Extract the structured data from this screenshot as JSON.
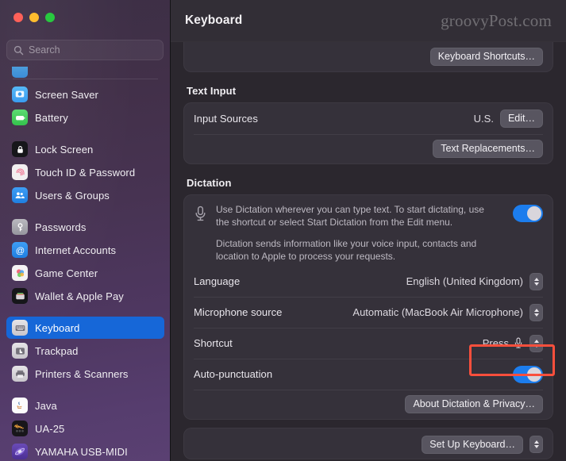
{
  "window": {
    "traffic_lights": [
      {
        "name": "close",
        "color": "#ff6159"
      },
      {
        "name": "minimize",
        "color": "#ffbd2e"
      },
      {
        "name": "zoom",
        "color": "#28c93f"
      }
    ]
  },
  "sidebar": {
    "search": {
      "placeholder": "Search",
      "value": ""
    },
    "groups": [
      {
        "items": [
          {
            "label": "",
            "icon": "app-icon",
            "clipped": true
          },
          {
            "label": "Screen Saver",
            "icon": "screen-saver-icon"
          },
          {
            "label": "Battery",
            "icon": "battery-icon"
          }
        ]
      },
      {
        "items": [
          {
            "label": "Lock Screen",
            "icon": "lock-screen-icon"
          },
          {
            "label": "Touch ID & Password",
            "icon": "touch-id-icon"
          },
          {
            "label": "Users & Groups",
            "icon": "users-groups-icon"
          }
        ]
      },
      {
        "items": [
          {
            "label": "Passwords",
            "icon": "passwords-key-icon"
          },
          {
            "label": "Internet Accounts",
            "icon": "internet-accounts-icon"
          },
          {
            "label": "Game Center",
            "icon": "game-center-icon"
          },
          {
            "label": "Wallet & Apple Pay",
            "icon": "wallet-icon"
          }
        ]
      },
      {
        "items": [
          {
            "label": "Keyboard",
            "icon": "keyboard-icon",
            "selected": true
          },
          {
            "label": "Trackpad",
            "icon": "trackpad-icon"
          },
          {
            "label": "Printers & Scanners",
            "icon": "printer-icon"
          }
        ]
      },
      {
        "items": [
          {
            "label": "Java",
            "icon": "java-icon"
          },
          {
            "label": "UA-25",
            "icon": "ua25-icon"
          },
          {
            "label": "YAMAHA USB-MIDI",
            "icon": "yamaha-icon"
          }
        ]
      }
    ],
    "selected_accent": "#1667d8"
  },
  "header": {
    "title": "Keyboard",
    "watermark": "groovyPost.com"
  },
  "main": {
    "top_card": {
      "button": "Keyboard Shortcuts…"
    },
    "text_input": {
      "section_title": "Text Input",
      "input_sources": {
        "label": "Input Sources",
        "value": "U.S.",
        "button": "Edit…"
      },
      "text_replacements_button": "Text Replacements…"
    },
    "dictation": {
      "section_title": "Dictation",
      "description_1": "Use Dictation wherever you can type text. To start dictating, use the shortcut or select Start Dictation from the Edit menu.",
      "description_2": "Dictation sends information like your voice input, contacts and location to Apple to process your requests.",
      "enabled": true,
      "rows": [
        {
          "label": "Language",
          "value": "English (United Kingdom)",
          "control": "stepper"
        },
        {
          "label": "Microphone source",
          "value": "Automatic (MacBook Air Microphone)",
          "control": "stepper"
        },
        {
          "label": "Shortcut",
          "value": "Press",
          "control": "stepper",
          "has_mic_glyph": true,
          "highlighted": true
        }
      ],
      "auto_punctuation": {
        "label": "Auto-punctuation",
        "enabled": true
      },
      "about_button": "About Dictation & Privacy…"
    },
    "bottom_card": {
      "button": "Set Up Keyboard…"
    }
  },
  "annotation": {
    "color": "#fa4f3c",
    "type": "arrow-and-box",
    "target": "Shortcut Press control"
  }
}
